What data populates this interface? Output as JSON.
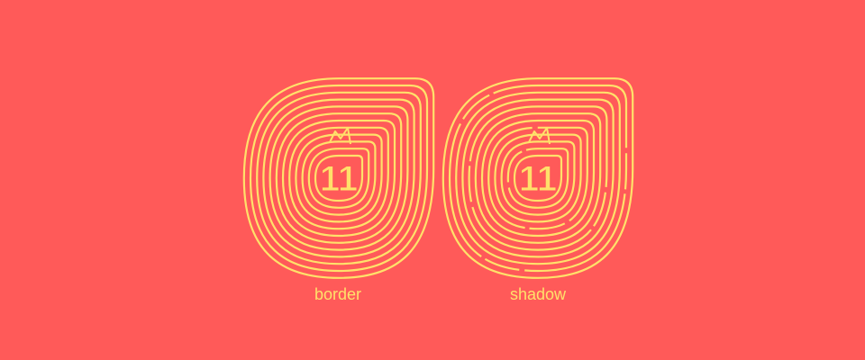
{
  "colors": {
    "background": "#ff5a59",
    "accent": "#ffe16a"
  },
  "badge_text": "11",
  "figures": [
    {
      "id": "border",
      "label": "border"
    },
    {
      "id": "shadow",
      "label": "shadow"
    }
  ]
}
